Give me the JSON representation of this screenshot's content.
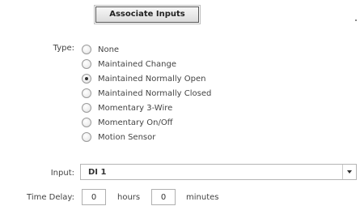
{
  "associate_button": {
    "label": "Associate Inputs"
  },
  "type": {
    "label": "Type:",
    "options": [
      {
        "label": "None",
        "checked": false
      },
      {
        "label": "Maintained Change",
        "checked": false
      },
      {
        "label": "Maintained Normally Open",
        "checked": true
      },
      {
        "label": "Maintained Normally Closed",
        "checked": false
      },
      {
        "label": "Momentary 3-Wire",
        "checked": false
      },
      {
        "label": "Momentary On/Off",
        "checked": false
      },
      {
        "label": "Motion Sensor",
        "checked": false
      }
    ]
  },
  "input": {
    "label": "Input:",
    "selected": "DI 1"
  },
  "time_delay": {
    "label": "Time Delay:",
    "hours_value": "0",
    "hours_unit": "hours",
    "minutes_value": "0",
    "minutes_unit": "minutes"
  }
}
